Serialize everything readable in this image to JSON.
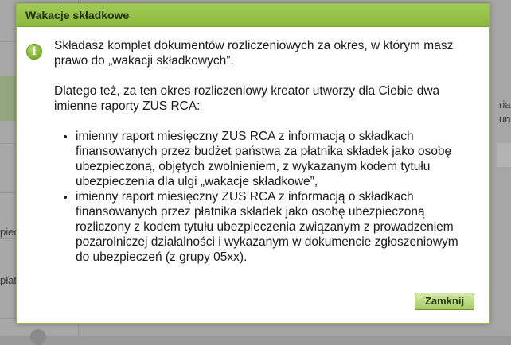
{
  "background": {
    "fragments": [
      "piecz",
      "płatni",
      "ria",
      "un"
    ]
  },
  "dialog": {
    "title": "Wakacje składkowe",
    "icon": "info-icon",
    "paragraph1": "Składasz komplet dokumentów rozliczeniowych za okres, w którym masz prawo do „wakacji składkowych”.",
    "paragraph2": "Dlatego też, za ten okres rozliczeniowy kreator utworzy dla Ciebie dwa imienne raporty ZUS RCA:",
    "bullets": [
      "imienny raport miesięczny ZUS RCA z informacją o składkach finansowanych przez budżet państwa za płatnika składek jako osobę ubezpieczoną, objętych zwolnieniem, z wykazanym kodem tytułu ubezpieczenia dla ulgi „wakacje składkowe”,",
      "imienny raport miesięczny ZUS RCA z informacją o składkach finansowanych przez płatnika składek jako osobę ubezpieczoną rozliczony z kodem tytułu ubezpieczenia związanym z prowadzeniem pozarolniczej działalności i wykazanym w dokumencie zgłoszeniowym do ubezpieczeń (z grupy 05xx)."
    ],
    "close_label": "Zamknij"
  },
  "colors": {
    "titlebar": "#97c247",
    "button": "#b9d97e",
    "overlay": "#a6a6a6"
  }
}
